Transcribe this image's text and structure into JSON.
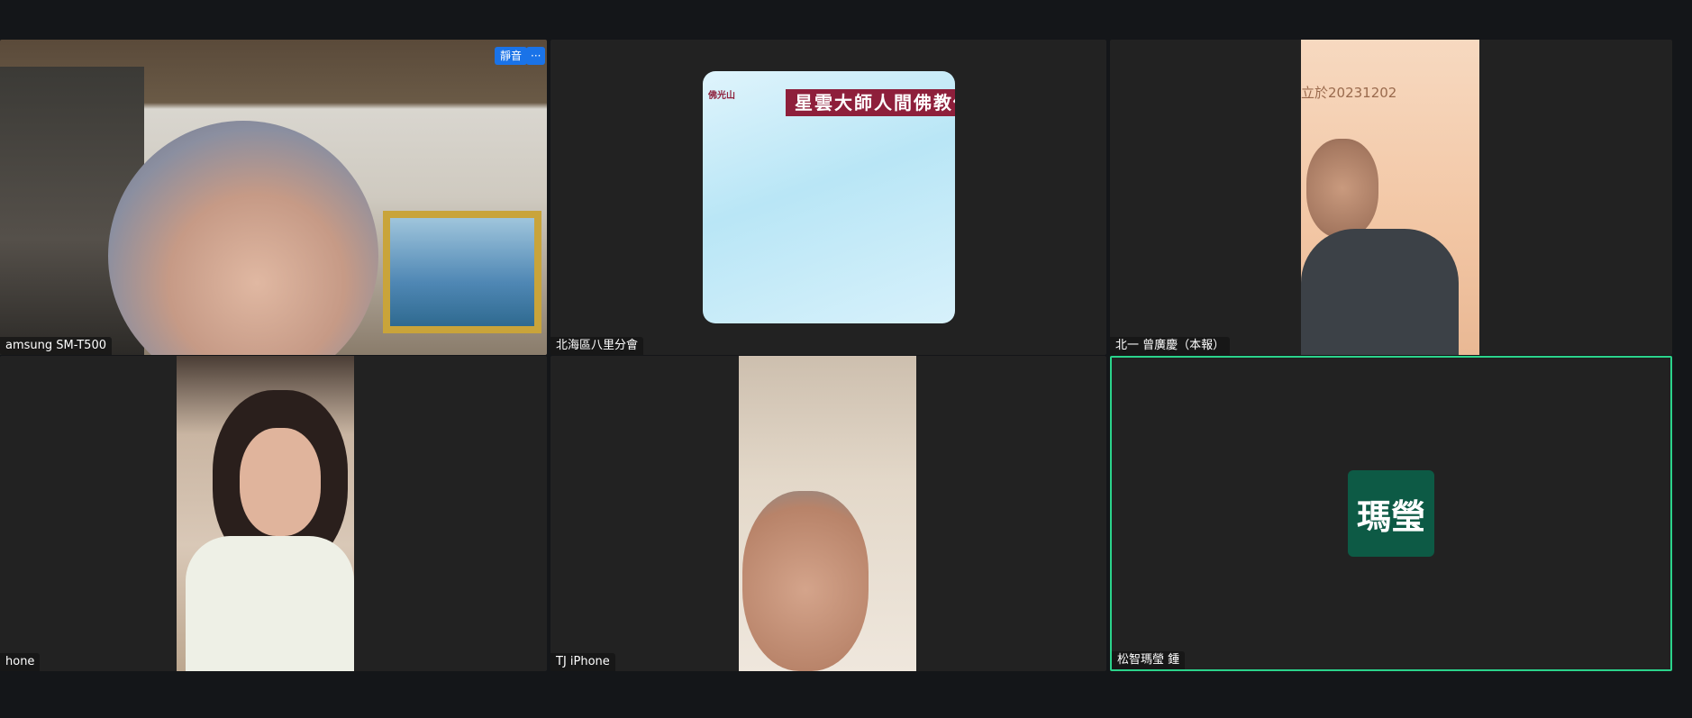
{
  "tiles": [
    {
      "name": "amsung SM-T500",
      "buttons": {
        "mute": "靜音",
        "more": "···"
      }
    },
    {
      "name": "北海區八里分會",
      "share": {
        "logo": "佛光山",
        "banner": "星雲大師人間佛教傳"
      }
    },
    {
      "name": "北一 曾廣慶（本報）",
      "overlay_text": "立於20231202"
    },
    {
      "name": "hone"
    },
    {
      "name": "TJ iPhone"
    },
    {
      "name": "松智瑪瑩 鍾",
      "avatar_text": "瑪瑩",
      "active": true
    }
  ],
  "colors": {
    "background": "#141619",
    "tile": "#222222",
    "active_border": "#2bd38b",
    "avatar_bg": "#0d5a45",
    "button_blue": "#1a73e8",
    "banner": "#8e1f3b"
  }
}
